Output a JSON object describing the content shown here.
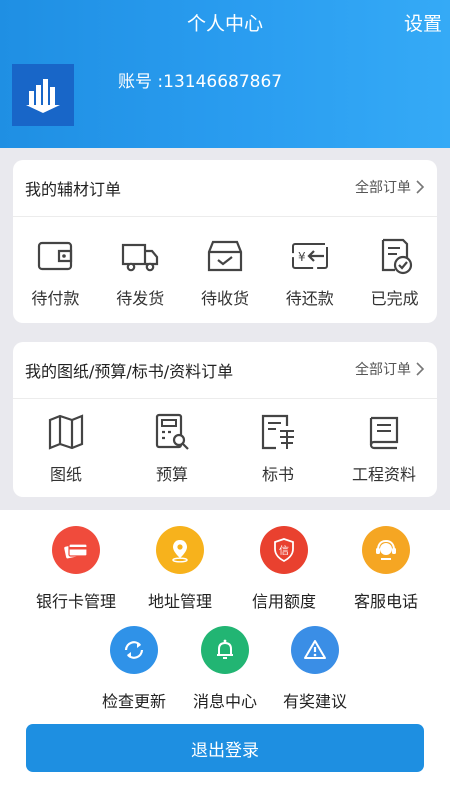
{
  "header": {
    "title": "个人中心",
    "settings_label": "设置"
  },
  "profile": {
    "account": "账号 :13146687867"
  },
  "card1": {
    "title": "我的辅材订单",
    "all_label": "全部订单",
    "items": [
      {
        "label": "待付款",
        "icon": "wallet-icon"
      },
      {
        "label": "待发货",
        "icon": "truck-icon"
      },
      {
        "label": "待收货",
        "icon": "inbox-icon"
      },
      {
        "label": "待还款",
        "icon": "repayment-icon"
      },
      {
        "label": "已完成",
        "icon": "completed-icon"
      }
    ]
  },
  "card2": {
    "title": "我的图纸/预算/标书/资料订单",
    "all_label": "全部订单",
    "items": [
      {
        "label": "图纸",
        "icon": "map-icon"
      },
      {
        "label": "预算",
        "icon": "calculator-icon"
      },
      {
        "label": "标书",
        "icon": "document-icon"
      },
      {
        "label": "工程资料",
        "icon": "book-icon"
      }
    ]
  },
  "services": [
    {
      "label": "银行卡管理",
      "icon": "bank-card-icon",
      "color": "#f04b3c"
    },
    {
      "label": "地址管理",
      "icon": "location-icon",
      "color": "#f7b21c"
    },
    {
      "label": "信用额度",
      "icon": "credit-shield-icon",
      "color": "#e9412f"
    },
    {
      "label": "客服电话",
      "icon": "customer-service-icon",
      "color": "#f5a623"
    },
    {
      "label": "检查更新",
      "icon": "refresh-icon",
      "color": "#2f92e8"
    },
    {
      "label": "消息中心",
      "icon": "bell-icon",
      "color": "#22b573"
    },
    {
      "label": "有奖建议",
      "icon": "warning-icon",
      "color": "#3a8ee6"
    }
  ],
  "credit_glyph": "信",
  "logout_label": "退出登录",
  "colors": {
    "primary": "#1e8fe1",
    "header_start": "#1f8fe3",
    "header_end": "#35aaf6"
  }
}
